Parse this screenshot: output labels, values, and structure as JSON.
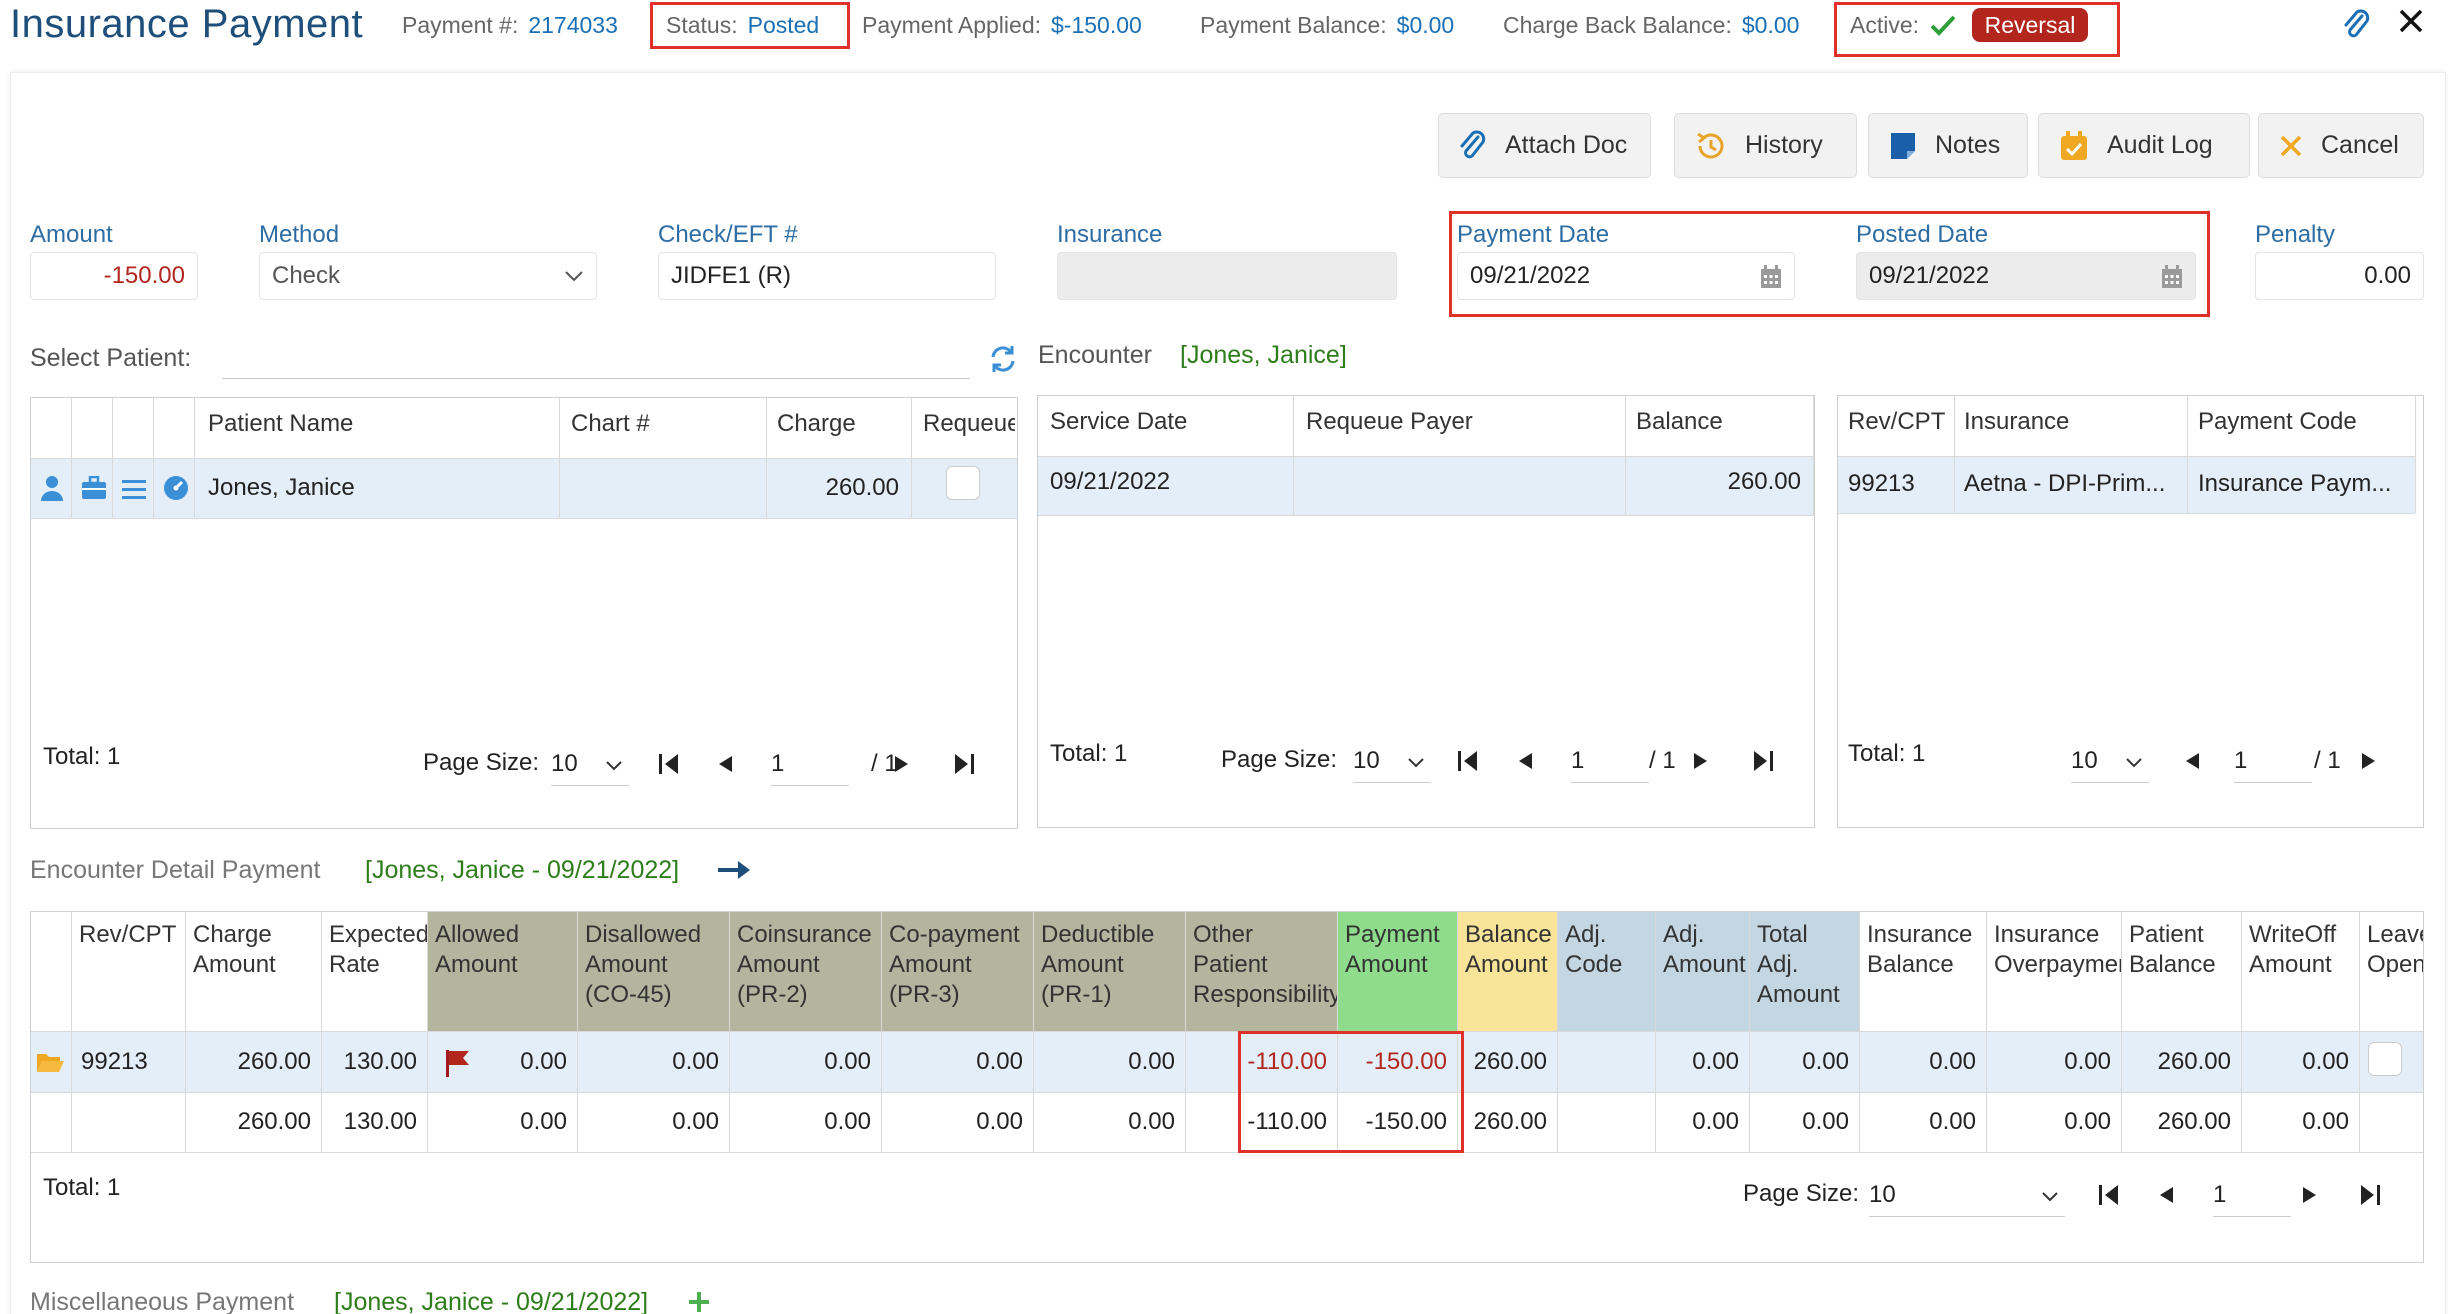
{
  "header": {
    "title": "Insurance Payment",
    "payment_no_label": "Payment #:",
    "payment_no": "2174033",
    "status_label": "Status:",
    "status": "Posted",
    "applied_label": "Payment Applied:",
    "applied": "$-150.00",
    "balance_label": "Payment Balance:",
    "balance": "$0.00",
    "chargeback_label": "Charge Back Balance:",
    "chargeback": "$0.00",
    "active_label": "Active:",
    "reversal": "Reversal"
  },
  "toolbar": {
    "attach_doc": "Attach Doc",
    "history": "History",
    "notes": "Notes",
    "audit_log": "Audit Log",
    "cancel": "Cancel"
  },
  "form": {
    "amount_label": "Amount",
    "amount": "-150.00",
    "method_label": "Method",
    "method": "Check",
    "check_label": "Check/EFT #",
    "check": "JIDFE1 (R)",
    "insurance_label": "Insurance",
    "insurance": "",
    "payment_date_label": "Payment Date",
    "payment_date": "09/21/2022",
    "posted_date_label": "Posted Date",
    "posted_date": "09/21/2022",
    "penalty_label": "Penalty",
    "penalty": "0.00"
  },
  "patient": {
    "select_label": "Select Patient:",
    "headers": [
      "Patient Name",
      "Chart #",
      "Charge",
      "Requeue"
    ],
    "row": {
      "name": "Jones, Janice",
      "chart": "",
      "charge": "260.00"
    },
    "total": "Total: 1",
    "page_size_label": "Page Size:",
    "page_size": "10",
    "page": "1",
    "page_of": "/ 1"
  },
  "encounter": {
    "label": "Encounter",
    "patient": "[Jones, Janice]",
    "headers": [
      "Service Date",
      "Requeue Payer",
      "Balance"
    ],
    "row": {
      "service_date": "09/21/2022",
      "requeue_payer": "",
      "balance": "260.00"
    },
    "total": "Total: 1",
    "page_size_label": "Page Size:",
    "page_size": "10",
    "page": "1",
    "page_of": "/ 1"
  },
  "charges": {
    "headers": [
      "Rev/CPT",
      "Insurance",
      "Payment Code"
    ],
    "row": {
      "cpt": "99213",
      "insurance": "Aetna - DPI-Prim...",
      "payment_code": "Insurance Paym..."
    },
    "total": "Total: 1",
    "page_size": "10",
    "page": "1",
    "page_of": "/ 1"
  },
  "detail": {
    "label": "Encounter Detail Payment",
    "patient": "[Jones, Janice - 09/21/2022]",
    "headers": [
      [
        "Rev/CPT"
      ],
      [
        "Charge",
        "Amount"
      ],
      [
        "Expected",
        "Rate"
      ],
      [
        "Allowed",
        "Amount"
      ],
      [
        "Disallowed",
        "Amount",
        "(CO-45)"
      ],
      [
        "Coinsurance",
        "Amount",
        "(PR-2)"
      ],
      [
        "Co-payment",
        "Amount",
        "(PR-3)"
      ],
      [
        "Deductible",
        "Amount",
        "(PR-1)"
      ],
      [
        "Other",
        "Patient",
        "Responsibility"
      ],
      [
        "Payment",
        "Amount"
      ],
      [
        "Balance",
        "Amount"
      ],
      [
        "Adj.",
        "Code"
      ],
      [
        "Adj.",
        "Amount"
      ],
      [
        "Total",
        "Adj.",
        "Amount"
      ],
      [
        "Insurance",
        "Balance"
      ],
      [
        "Insurance",
        "Overpayment"
      ],
      [
        "Patient",
        "Balance"
      ],
      [
        "WriteOff",
        "Amount"
      ],
      [
        "Leave",
        "Open"
      ]
    ],
    "row1": [
      "99213",
      "260.00",
      "130.00",
      "0.00",
      "0.00",
      "0.00",
      "0.00",
      "0.00",
      "-110.00",
      "-150.00",
      "260.00",
      "",
      "0.00",
      "0.00",
      "0.00",
      "0.00",
      "260.00",
      "0.00"
    ],
    "row2": [
      "",
      "260.00",
      "130.00",
      "0.00",
      "0.00",
      "0.00",
      "0.00",
      "0.00",
      "-110.00",
      "-150.00",
      "260.00",
      "",
      "0.00",
      "0.00",
      "0.00",
      "0.00",
      "260.00",
      "0.00"
    ],
    "total": "Total: 1",
    "page_size_label": "Page Size:",
    "page_size": "10",
    "page": "1"
  },
  "misc": {
    "label": "Miscellaneous Payment",
    "patient": "[Jones, Janice - 09/21/2022]"
  },
  "colors": {
    "brand_blue": "#1a6fb5",
    "reversal_red": "#b3261e",
    "highlight_box": "#e0302a",
    "adjust_col_olive": "#b3b59f",
    "payment_col_green": "#8fdc8c",
    "balance_col_yellow": "#f8e59a",
    "adj_col_blue": "#c4d6e2"
  }
}
